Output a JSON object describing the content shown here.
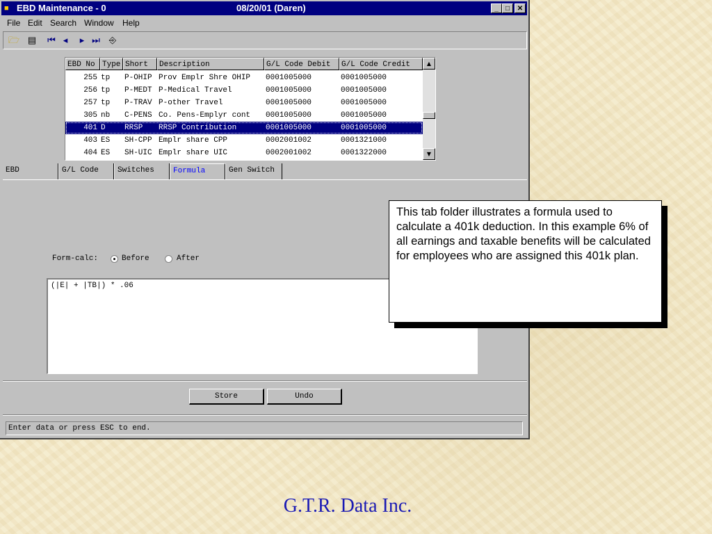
{
  "window": {
    "title": "EBD Maintenance - 0",
    "title_date": "08/20/01 (Daren)",
    "minimize": "_",
    "maximize": "□",
    "close": "✕"
  },
  "menu": {
    "file": "File",
    "edit": "Edit",
    "search": "Search",
    "window": "Window",
    "help": "Help"
  },
  "grid": {
    "headers": [
      "EBD No",
      "Type",
      "Short",
      "Description",
      "G/L Code Debit",
      "G/L Code Credit"
    ],
    "rows": [
      {
        "no": "255",
        "type": "tp",
        "short": "P-OHIP",
        "desc": "Prov Emplr Shre OHIP",
        "debit": "0001005000",
        "credit": "0001005000"
      },
      {
        "no": "256",
        "type": "tp",
        "short": "P-MEDT",
        "desc": "P-Medical Travel",
        "debit": "0001005000",
        "credit": "0001005000"
      },
      {
        "no": "257",
        "type": "tp",
        "short": "P-TRAV",
        "desc": "P-other Travel",
        "debit": "0001005000",
        "credit": "0001005000"
      },
      {
        "no": "305",
        "type": "nb",
        "short": "C-PENS",
        "desc": "Co. Pens-Emplyr cont",
        "debit": "0001005000",
        "credit": "0001005000"
      },
      {
        "no": "401",
        "type": "D",
        "short": "RRSP",
        "desc": "RRSP Contribution",
        "debit": "0001005000",
        "credit": "0001005000"
      },
      {
        "no": "403",
        "type": "ES",
        "short": "SH-CPP",
        "desc": "Emplr share CPP",
        "debit": "0002001002",
        "credit": "0001321000"
      },
      {
        "no": "404",
        "type": "ES",
        "short": "SH-UIC",
        "desc": "Emplr share UIC",
        "debit": "0002001002",
        "credit": "0001322000"
      }
    ],
    "selected_row_index": 4
  },
  "tabs": {
    "ebd": "EBD",
    "gl_code": "G/L Code",
    "switches": "Switches",
    "formula": "Formula",
    "gen_switch": "Gen Switch",
    "active": "Formula"
  },
  "formula": {
    "form_calc_label": "Form-calc:",
    "before_label": "Before",
    "after_label": "After",
    "selected": "Before",
    "expression": "(|E| + |TB|) * .06"
  },
  "buttons": {
    "store": "Store",
    "undo": "Undo"
  },
  "status": "Enter data or press ESC to end.",
  "callout": "This tab folder illustrates a formula used to calculate a 401k deduction. In this example 6% of all earnings and taxable benefits will be calculated for employees who are assigned this 401k plan.",
  "footer": "G.T.R. Data Inc."
}
